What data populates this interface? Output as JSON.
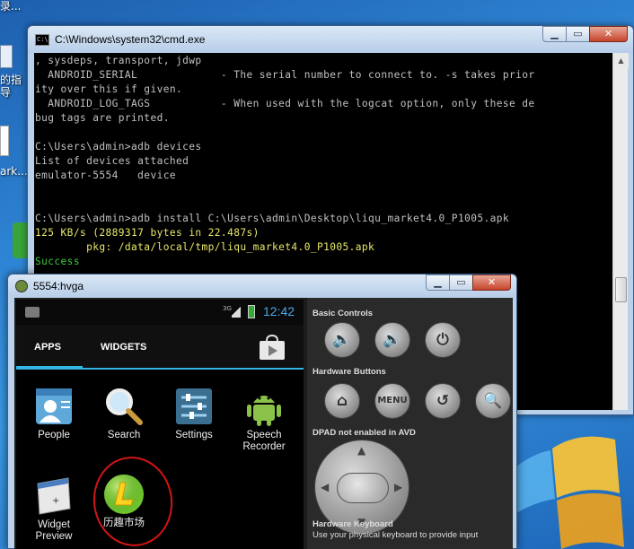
{
  "desktop": {
    "text_top": "录...",
    "text_mid": "的指\n导",
    "text_ark": "ark..."
  },
  "cmd": {
    "title": "C:\\Windows\\system32\\cmd.exe",
    "icon_text": "C:\\",
    "controls": {
      "minimize": "▁",
      "maximize": "▭",
      "close": "✕"
    },
    "lines": [
      {
        "text": ", sysdeps, transport, jdwp",
        "color": "grey"
      },
      {
        "text": "  ANDROID_SERIAL             - The serial number to connect to. -s takes prior",
        "color": "grey"
      },
      {
        "text": "ity over this if given.",
        "color": "grey"
      },
      {
        "text": "  ANDROID_LOG_TAGS           - When used with the logcat option, only these de",
        "color": "grey"
      },
      {
        "text": "bug tags are printed.",
        "color": "grey"
      },
      {
        "text": "",
        "color": "grey"
      },
      {
        "text": "C:\\Users\\admin>adb devices",
        "color": "grey"
      },
      {
        "text": "List of devices attached",
        "color": "grey"
      },
      {
        "text": "emulator-5554   device",
        "color": "grey"
      },
      {
        "text": "",
        "color": "grey"
      },
      {
        "text": "",
        "color": "grey"
      },
      {
        "text": "C:\\Users\\admin>adb install C:\\Users\\admin\\Desktop\\liqu_market4.0_P1005.apk",
        "color": "grey"
      },
      {
        "text": "125 KB/s (2889317 bytes in 22.487s)",
        "color": "yellow"
      },
      {
        "text": "        pkg: /data/local/tmp/liqu_market4.0_P1005.apk",
        "color": "yellow"
      },
      {
        "text": "Success",
        "color": "green"
      }
    ]
  },
  "emulator": {
    "title": "5554:hvga",
    "controls": {
      "minimize": "▁",
      "maximize": "▭",
      "close": "✕"
    },
    "status": {
      "network": "3G",
      "time": "12:42"
    },
    "tabs": {
      "apps": "APPS",
      "widgets": "WIDGETS"
    },
    "apps": [
      {
        "name": "People",
        "icon": "people-icon"
      },
      {
        "name": "Search",
        "icon": "search-icon"
      },
      {
        "name": "Settings",
        "icon": "settings-icon"
      },
      {
        "name": "Speech\nRecorder",
        "icon": "android-robot-icon"
      },
      {
        "name": "Widget\nPreview",
        "icon": "widget-preview-icon"
      },
      {
        "name": "历趣市场",
        "icon": "liqu-market-icon"
      }
    ],
    "panel": {
      "basic_controls": "Basic Controls",
      "hardware_buttons": "Hardware Buttons",
      "dpad_note": "DPAD not enabled in AVD",
      "keyboard_title": "Hardware Keyboard",
      "keyboard_note": "Use your physical keyboard to provide input",
      "menu_label": "MENU"
    }
  },
  "colors": {
    "cmd_text": "#c0c0c0",
    "cmd_yellow": "#e8e86a",
    "cmd_green": "#3ec83e",
    "android_accent": "#33b5e5",
    "annotation_red": "#d31515"
  }
}
